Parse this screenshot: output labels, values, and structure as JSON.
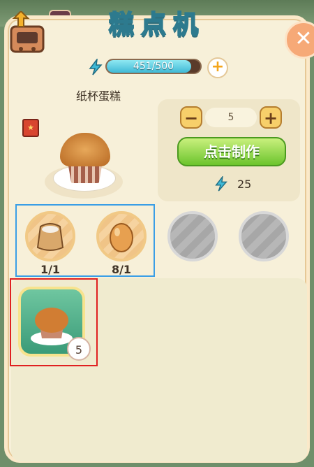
{
  "window": {
    "title": "糕点机"
  },
  "energy": {
    "current_max": "451/500",
    "fill_fraction": 0.902
  },
  "product": {
    "name": "纸杯蛋糕"
  },
  "craft": {
    "quantity": "5",
    "make_label": "点击制作",
    "cost": "25"
  },
  "ingredients": [
    {
      "icon": "flour-sack-icon",
      "count": "1/1"
    },
    {
      "icon": "egg-icon",
      "count": "8/1"
    },
    {
      "icon": "empty-slot-icon",
      "count": ""
    },
    {
      "icon": "empty-slot-icon",
      "count": ""
    }
  ],
  "output": {
    "count": "5",
    "icon": "cupcake-icon"
  },
  "colors": {
    "accent_green": "#6cc42d",
    "energy": "#3fb9d6",
    "highlight_blue": "#3a9ee6",
    "highlight_red": "#e02020"
  }
}
